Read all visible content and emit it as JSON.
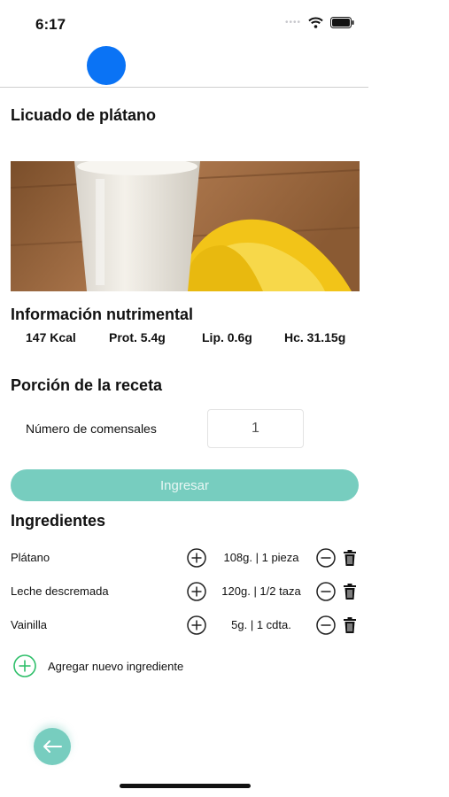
{
  "status": {
    "time": "6:17"
  },
  "recipe": {
    "title": "Licuado de plátano"
  },
  "nutrition": {
    "heading": "Información nutrimental",
    "kcal": "147 Kcal",
    "protein": "Prot. 5.4g",
    "lipids": "Lip. 0.6g",
    "carbs": "Hc. 31.15g"
  },
  "portion": {
    "heading": "Porción de la receta",
    "diners_label": "Número de comensales",
    "diners_value": "1",
    "submit_label": "Ingresar"
  },
  "ingredients": {
    "heading": "Ingredientes",
    "items": [
      {
        "name": "Plátano",
        "quantity": "108g. | 1 pieza"
      },
      {
        "name": "Leche descremada",
        "quantity": "120g. |  1/2 taza"
      },
      {
        "name": "Vainilla",
        "quantity": "5g. | 1 cdta."
      }
    ],
    "add_label": "Agregar nuevo ingrediente"
  },
  "colors": {
    "accent": "#77cdbf",
    "nav_dot": "#0a73f5",
    "add_icon": "#2fbf6a"
  }
}
